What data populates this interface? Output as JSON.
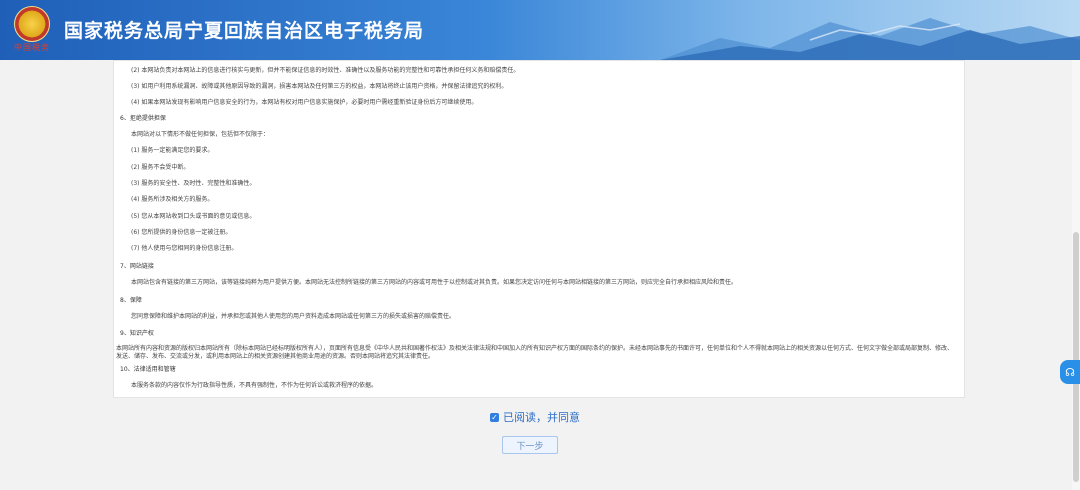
{
  "header": {
    "emblem_text": "中国税务",
    "title": "国家税务总局宁夏回族自治区电子税务局"
  },
  "terms": {
    "lines": [
      {
        "kind": "sub",
        "text": "(2) 本网站负责对本网站上的信息进行核实与更新，但并不能保证信息的时效性、准确性以及服务功能的完整性和可靠性承担任何义务和赔偿责任。"
      },
      {
        "kind": "sub",
        "text": "(3) 如用户利用系统漏洞、故障或其他原因导致的漏洞，损害本网站及任何第三方的权益，本网站将终止该用户资格，并保留法律追究的权利。"
      },
      {
        "kind": "sub",
        "text": "(4) 如果本网站发现有影响用户信息安全的行为，本网站有权对用户信息实施保护，必要时用户需经重新验证身份后方可继续使用。"
      },
      {
        "kind": "sec",
        "text": "6、拒绝提供担保"
      },
      {
        "kind": "sub",
        "text": "本网站对以下情形不做任何担保，包括但不仅限于："
      },
      {
        "kind": "sub",
        "text": "(1) 服务一定能满足您的要求。"
      },
      {
        "kind": "sub",
        "text": "(2) 服务不会受中断。"
      },
      {
        "kind": "sub",
        "text": "(3) 服务的安全性、及时性、完整性和准确性。"
      },
      {
        "kind": "sub",
        "text": "(4) 服务所涉及相关方的服务。"
      },
      {
        "kind": "sub",
        "text": "(5) 您从本网站收到口头或书面的意见或信息。"
      },
      {
        "kind": "sub",
        "text": "(6) 您所提供的身份信息一定被注册。"
      },
      {
        "kind": "sub",
        "text": "(7) 他人使用与您相同的身份信息注册。"
      },
      {
        "kind": "sec",
        "text": "7、网站链接"
      },
      {
        "kind": "sub",
        "text": "本网站包含有链接的第三方网站，该等链接纯粹为用户提供方便。本网站无法控制所链接的第三方网站的内容或可用性于以控制或对其负责。如果您决定访问任何与本网站相链接的第三方网站，则应完全自行承担相应风险和责任。"
      },
      {
        "kind": "sec",
        "text": "8、保障"
      },
      {
        "kind": "sub",
        "text": "您同意保障和维护本网站的利益，并承担您或其他人使用您的用户资料造成本网站或任何第三方的损失或损害的赔偿责任。"
      },
      {
        "kind": "sec",
        "text": "9、知识产权"
      },
      {
        "kind": "para",
        "text": "本网站所有内容和资源的版权归本网站所有（除标本网站已经标明版权所有人），页面所有信息受《中华人民共和国著作权法》及相关法律法规和中国加入的所有知识产权方面的国际条约的保护。未经本网站事先的书面许可，任何单位和个人不得就本网站上的相关资源以任何方式、任何文字做全部或局部复制、修改、发送、储存、发布、交流或分发，或利用本网站上的相关资源创建其他商业用途的资源。否则本网站将追究其法律责任。"
      },
      {
        "kind": "sec",
        "text": "10、法律适用和管辖"
      },
      {
        "kind": "sub",
        "text": "本服务条款的内容仅作为行政指导性质，不具有强制性，不作为任何诉讼或救济程序的依据。"
      }
    ]
  },
  "agreement": {
    "checked": true,
    "label": "已阅读，并同意"
  },
  "next_button": {
    "label": "下一步"
  },
  "colors": {
    "header_start": "#1f5fb8",
    "accent": "#2f7ee0",
    "button_border": "#a9c6ef",
    "float_button": "#2a8fe6"
  }
}
